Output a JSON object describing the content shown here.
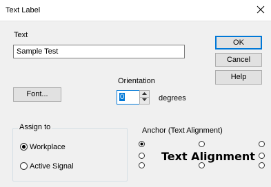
{
  "window": {
    "title": "Text Label"
  },
  "text_section": {
    "label": "Text",
    "value": "Sample Test"
  },
  "buttons": {
    "ok": "OK",
    "cancel": "Cancel",
    "help": "Help",
    "font": "Font..."
  },
  "orientation": {
    "label": "Orientation",
    "value": "0",
    "unit": "degrees"
  },
  "assign_to": {
    "title": "Assign to",
    "options": [
      "Workplace",
      "Active Signal"
    ],
    "selected": "Workplace"
  },
  "anchor": {
    "title": "Anchor (Text Alignment)",
    "preview_text": "Text Alignment",
    "selected": "top-left"
  },
  "colors": {
    "accent": "#0078d7"
  }
}
